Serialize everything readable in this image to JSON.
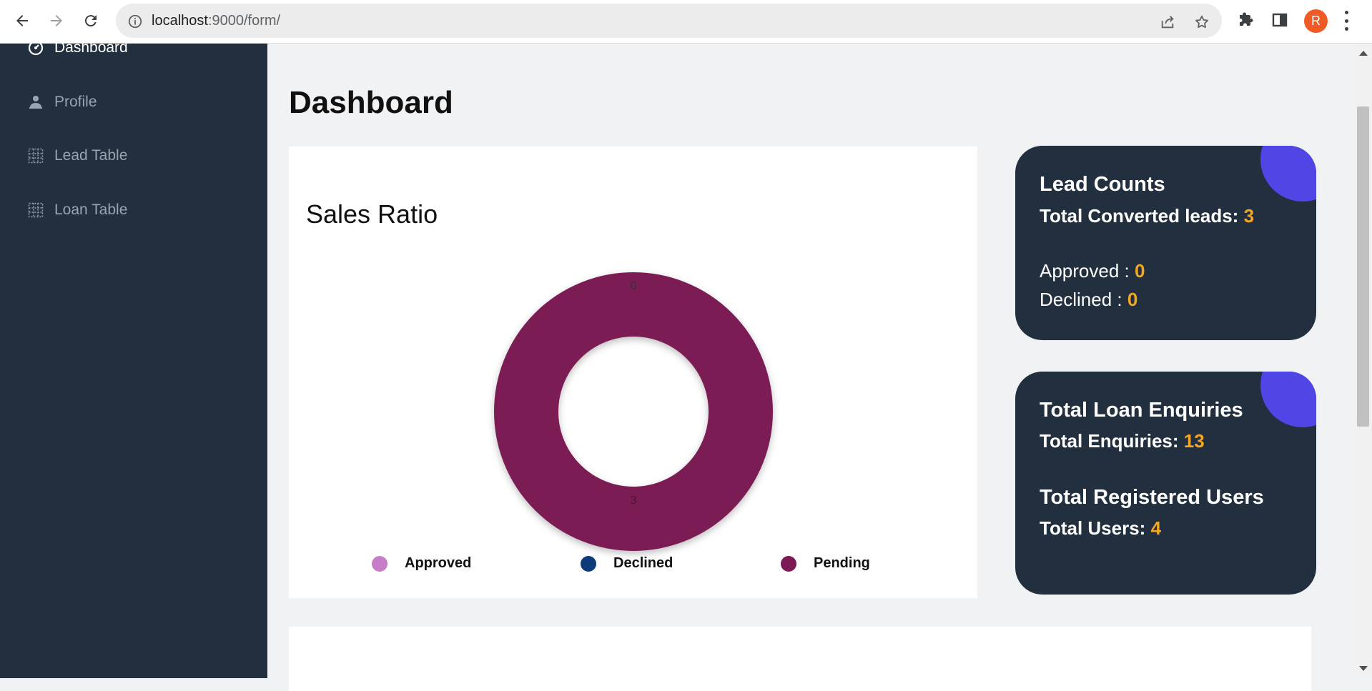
{
  "browser": {
    "url_host": "localhost",
    "url_path": ":9000/form/",
    "avatar_letter": "R"
  },
  "sidebar": {
    "items": [
      {
        "label": "Dashboard",
        "icon": "dashboard-icon",
        "active": true
      },
      {
        "label": "Profile",
        "icon": "profile-icon",
        "active": false
      },
      {
        "label": "Lead Table",
        "icon": "grid-icon",
        "active": false
      },
      {
        "label": "Loan Table",
        "icon": "grid-icon",
        "active": false
      }
    ]
  },
  "main": {
    "title": "Dashboard"
  },
  "chart_data": {
    "type": "pie",
    "title": "Sales Ratio",
    "categories": [
      "Approved",
      "Declined",
      "Pending"
    ],
    "values": [
      0,
      0,
      3
    ],
    "colors": [
      "#c77dc7",
      "#0d3b7a",
      "#7b1a55"
    ],
    "data_labels": [
      "0",
      "3"
    ],
    "legend": "bottom"
  },
  "lead_counts": {
    "heading": "Lead Counts",
    "converted_label": "Total Converted leads: ",
    "converted_value": "3",
    "approved_label": "Approved : ",
    "approved_value": "0",
    "declined_label": "Declined : ",
    "declined_value": "0"
  },
  "enquiries": {
    "heading": "Total Loan Enquiries",
    "enquiries_label": "Total Enquiries: ",
    "enquiries_value": "13",
    "users_heading": "Total Registered Users",
    "users_label": "Total Users: ",
    "users_value": "4"
  },
  "colors": {
    "sidebar_bg": "#222f3e",
    "accent": "#4f46e5",
    "highlight_number": "#f5a623"
  }
}
